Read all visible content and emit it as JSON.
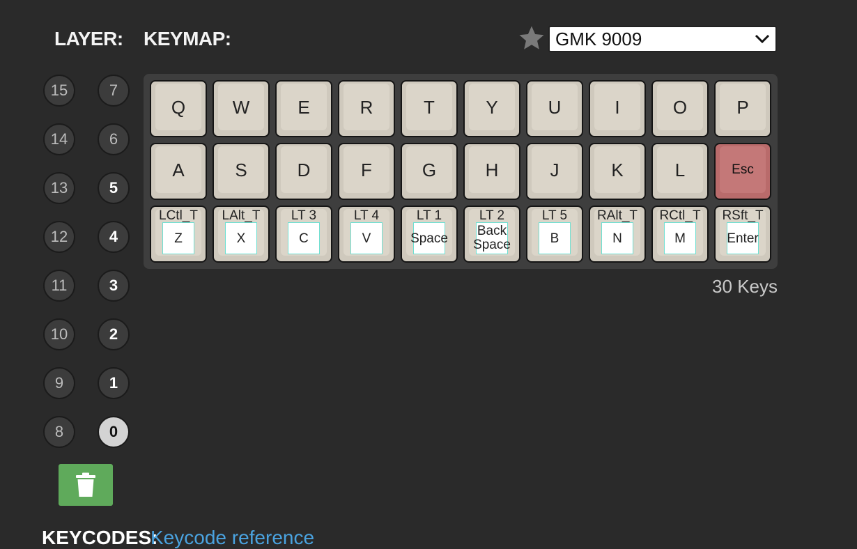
{
  "header": {
    "layer_label": "LAYER:",
    "keymap_label": "KEYMAP:",
    "preset_value": "GMK 9009"
  },
  "layers": {
    "left": [
      "15",
      "14",
      "13",
      "12",
      "11",
      "10",
      "9",
      "8"
    ],
    "right": [
      "7",
      "6",
      "5",
      "4",
      "3",
      "2",
      "1",
      "0"
    ],
    "active": "0"
  },
  "keys": {
    "row1": [
      "Q",
      "W",
      "E",
      "R",
      "T",
      "Y",
      "U",
      "I",
      "O",
      "P"
    ],
    "row2": [
      "A",
      "S",
      "D",
      "F",
      "G",
      "H",
      "J",
      "K",
      "L",
      "Esc"
    ],
    "row3": [
      {
        "mod": "LCtl_T",
        "key": "Z"
      },
      {
        "mod": "LAlt_T",
        "key": "X"
      },
      {
        "mod": "LT 3",
        "key": "C"
      },
      {
        "mod": "LT 4",
        "key": "V"
      },
      {
        "mod": "LT 1",
        "key": "Space"
      },
      {
        "mod": "LT 2",
        "key": "Back\nSpace"
      },
      {
        "mod": "LT 5",
        "key": "B"
      },
      {
        "mod": "RAlt_T",
        "key": "N"
      },
      {
        "mod": "RCtl_T",
        "key": "M"
      },
      {
        "mod": "RSft_T",
        "key": "Enter"
      }
    ]
  },
  "key_count": "30 Keys",
  "footer": {
    "keycodes_label": "KEYCODES:",
    "keycodes_link": "Keycode reference"
  },
  "colors": {
    "background": "#2a2a2a",
    "keycap": "#cfc9bd",
    "esc_keycap": "#b96b6b",
    "trash_button": "#5faa5b",
    "link": "#4aa3e0"
  },
  "icons": {
    "star": "star-icon",
    "select_arrow": "chevron-down-icon",
    "trash": "trash-icon"
  }
}
